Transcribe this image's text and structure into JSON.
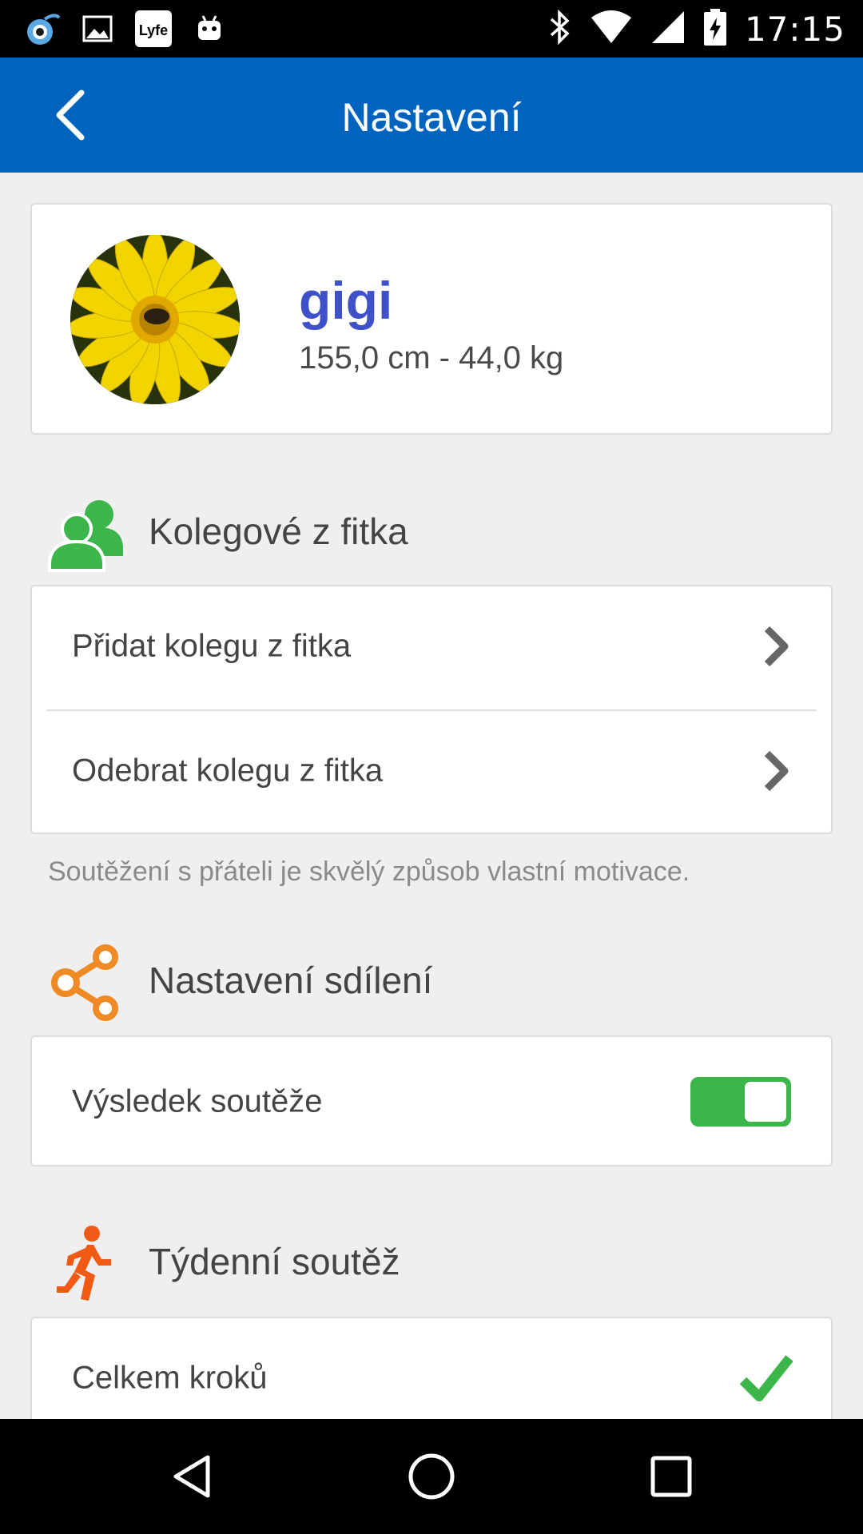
{
  "status_bar": {
    "time": "17:15",
    "left_icons": [
      "notification-app-icon",
      "image-icon",
      "lyfe-icon",
      "android-icon"
    ],
    "right_icons": [
      "bluetooth-icon",
      "wifi-icon",
      "signal-icon",
      "battery-charging-icon"
    ]
  },
  "appbar": {
    "title": "Nastavení",
    "back_icon": "chevron-left-icon",
    "color": "#0063be"
  },
  "profile": {
    "name": "gigi",
    "stats": "155,0 cm - 44,0 kg",
    "avatar": "sunflower-photo"
  },
  "sections": {
    "friends": {
      "title": "Kolegové z fitka",
      "icon": "people-icon",
      "icon_color": "#3cb64b",
      "items": [
        {
          "label": "Přidat kolegu z fitka"
        },
        {
          "label": "Odebrat kolegu z fitka"
        }
      ],
      "hint": "Soutěžení s přáteli je skvělý způsob vlastní motivace."
    },
    "sharing": {
      "title": "Nastavení sdílení",
      "icon": "share-icon",
      "icon_color": "#f08a24",
      "items": [
        {
          "label": "Výsledek soutěže",
          "toggle_on": true
        }
      ]
    },
    "weekly": {
      "title": "Týdenní soutěž",
      "icon": "running-person-icon",
      "icon_color": "#f05a14",
      "items": [
        {
          "label": "Celkem kroků",
          "checked": true
        }
      ]
    }
  },
  "navbar": {
    "icons": [
      "back-triangle-icon",
      "home-circle-icon",
      "recents-square-icon"
    ]
  },
  "colors": {
    "accent_green": "#3cb64b",
    "name_blue": "#3f51c9"
  }
}
